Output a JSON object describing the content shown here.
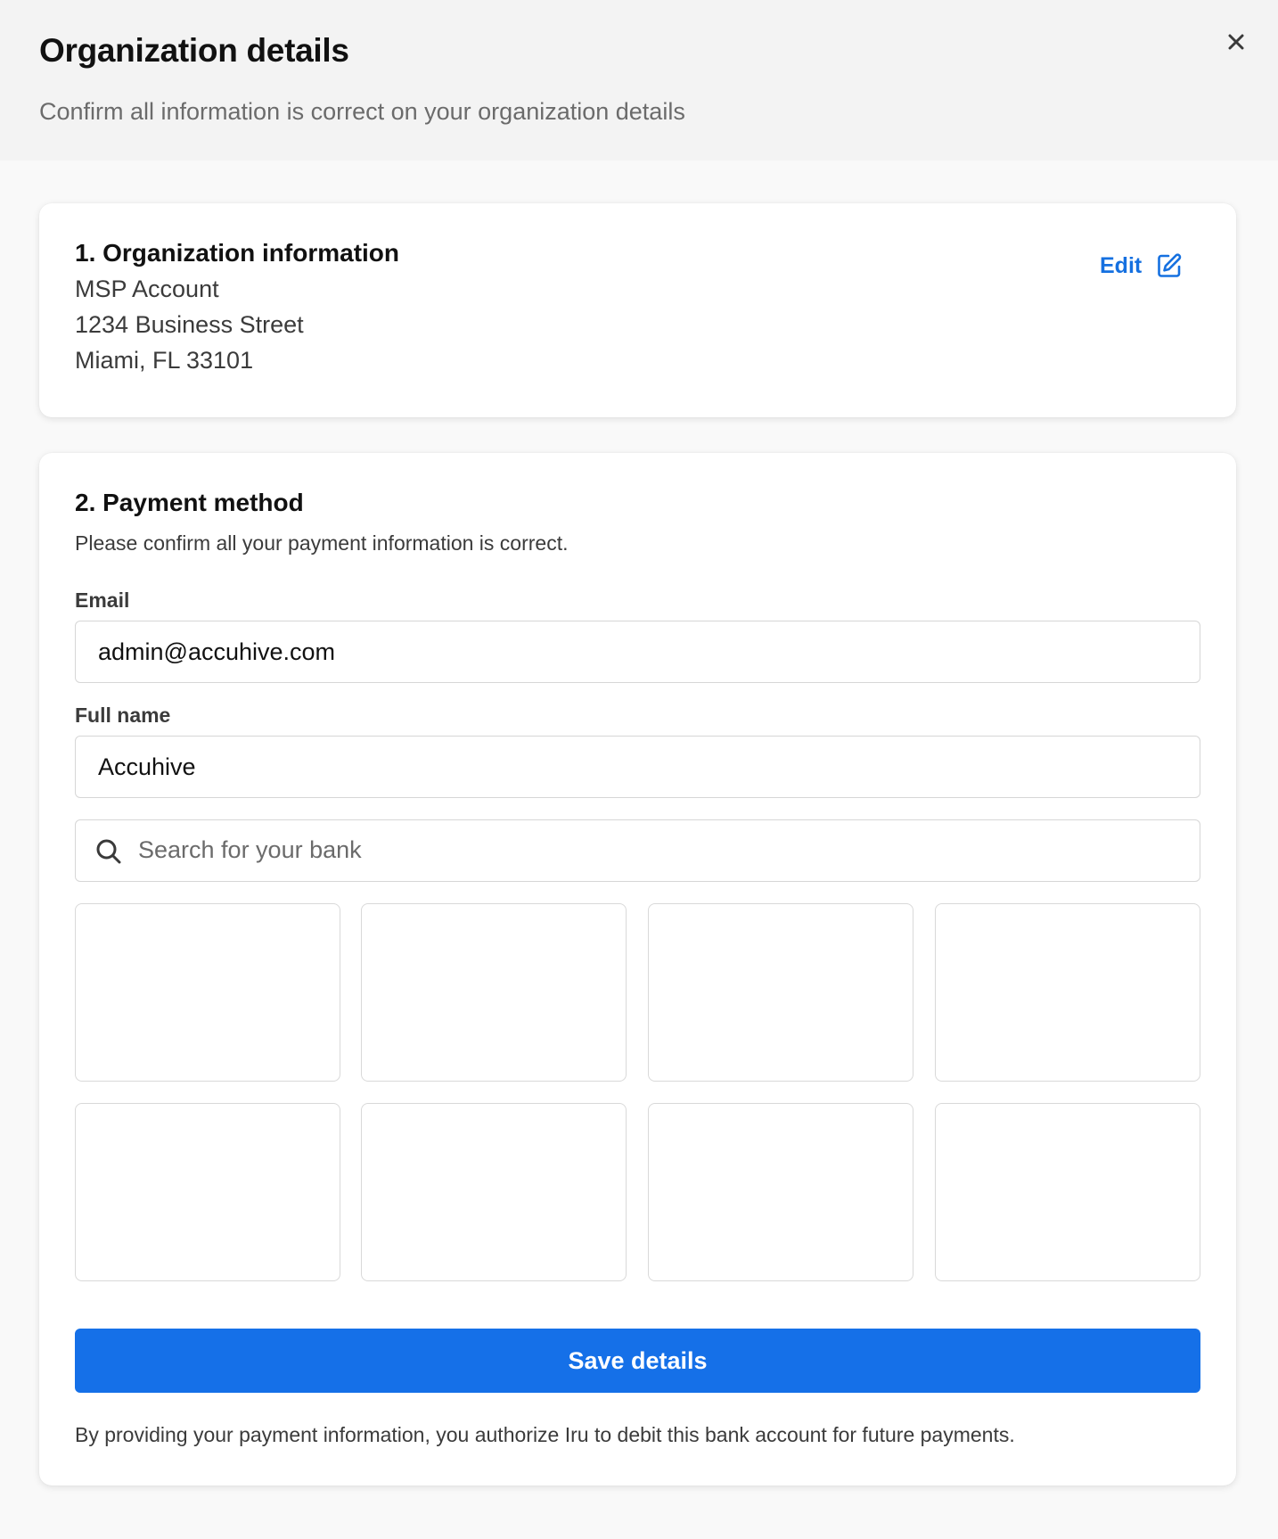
{
  "header": {
    "title": "Organization details",
    "subtitle": "Confirm all information is correct on your organization details",
    "close_icon": "close-icon"
  },
  "organization": {
    "title": "1. Organization information",
    "name": "MSP Account",
    "address_line1": "1234 Business Street",
    "address_line2": "Miami, FL 33101",
    "edit_label": "Edit",
    "edit_icon": "edit-icon"
  },
  "payment": {
    "title": "2. Payment method",
    "subtitle": "Please confirm all your payment information is correct.",
    "email_label": "Email",
    "email_value": "admin@accuhive.com",
    "fullname_label": "Full name",
    "fullname_value": "Accuhive",
    "search_placeholder": "Search for your bank",
    "search_icon": "search-icon",
    "bank_tiles_count": 8,
    "save_label": "Save details",
    "disclaimer": "By providing your payment information, you authorize Iru to debit this bank account for future payments."
  },
  "colors": {
    "accent": "#1570e8",
    "link": "#1570e0",
    "header_bg": "#f3f3f3",
    "page_bg": "#f9f9f9"
  }
}
